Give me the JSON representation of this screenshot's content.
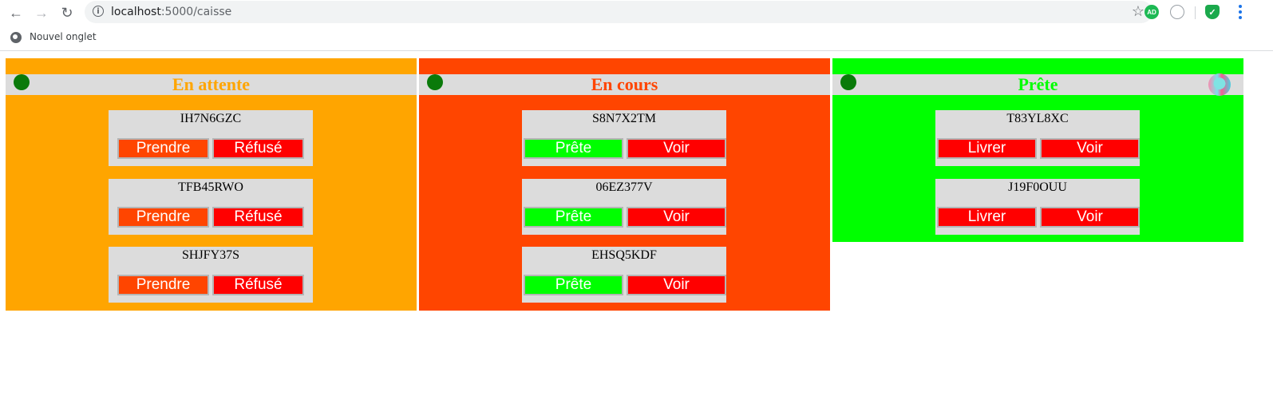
{
  "browser": {
    "url_host": "localhost",
    "url_path": ":5000/caisse",
    "bookmark_label": "Nouvel onglet",
    "icons": [
      "back-arrow-icon",
      "forward-arrow-icon",
      "reload-icon",
      "info-icon",
      "star-icon",
      "adblock-extension-icon",
      "extension-icon",
      "shield-extension-icon",
      "menu-icon",
      "globe-icon"
    ]
  },
  "columns": [
    {
      "title": "En attente",
      "bg": "#ffa500",
      "title_color": "#ffa500",
      "orders": [
        {
          "code": "IH7N6GZC",
          "btn1": "Prendre",
          "btn2": "Réfusé"
        },
        {
          "code": "TFB45RWO",
          "btn1": "Prendre",
          "btn2": "Réfusé"
        },
        {
          "code": "SHJFY37S",
          "btn1": "Prendre",
          "btn2": "Réfusé"
        }
      ],
      "btn1_color": "#ff4500",
      "btn2_color": "#ff0000"
    },
    {
      "title": "En cours",
      "bg": "#ff4500",
      "title_color": "#ff4500",
      "orders": [
        {
          "code": "S8N7X2TM",
          "btn1": "Prête",
          "btn2": "Voir"
        },
        {
          "code": "06EZ377V",
          "btn1": "Prête",
          "btn2": "Voir"
        },
        {
          "code": "EHSQ5KDF",
          "btn1": "Prête",
          "btn2": "Voir"
        }
      ],
      "btn1_color": "#00ff00",
      "btn2_color": "#ff0000"
    },
    {
      "title": "Prête",
      "bg": "#00ff00",
      "title_color": "#00ff00",
      "orders": [
        {
          "code": "T83YL8XC",
          "btn1": "Livrer",
          "btn2": "Voir"
        },
        {
          "code": "J19F0OUU",
          "btn1": "Livrer",
          "btn2": "Voir"
        }
      ],
      "btn1_color": "#ff0000",
      "btn2_color": "#ff0000"
    }
  ],
  "colors": {
    "header_bar": "#dcdcdc",
    "status_dot": "#0a7a0a",
    "card_bg": "#dcdcdc"
  }
}
